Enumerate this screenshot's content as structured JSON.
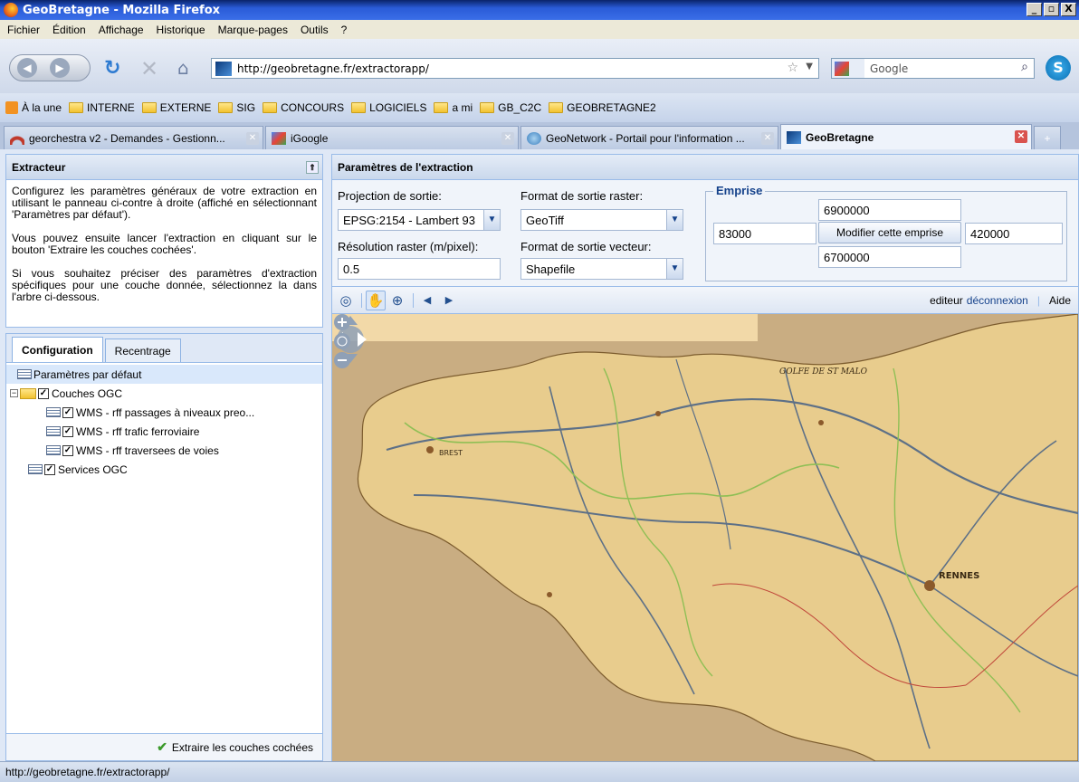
{
  "window": {
    "title": "GeoBretagne - Mozilla Firefox",
    "buttons": [
      "_",
      "▫",
      "X"
    ]
  },
  "menu": [
    "Fichier",
    "Édition",
    "Affichage",
    "Historique",
    "Marque-pages",
    "Outils",
    "?"
  ],
  "nav": {
    "url": "http://geobretagne.fr/extractorapp/",
    "search_engine": "Google",
    "search_placeholder": "Google"
  },
  "bookmarks": [
    {
      "label": "À la une",
      "icon": "rss-icon"
    },
    {
      "label": "INTERNE",
      "icon": "folder-icon"
    },
    {
      "label": "EXTERNE",
      "icon": "folder-icon"
    },
    {
      "label": "SIG",
      "icon": "folder-icon"
    },
    {
      "label": "CONCOURS",
      "icon": "folder-icon"
    },
    {
      "label": "LOGICIELS",
      "icon": "folder-icon"
    },
    {
      "label": "a mi",
      "icon": "folder-icon"
    },
    {
      "label": "GB_C2C",
      "icon": "folder-icon"
    },
    {
      "label": "GEOBRETAGNE2",
      "icon": "folder-icon"
    }
  ],
  "tabs": [
    {
      "label": "georchestra v2 - Demandes - Gestionn...",
      "active": false
    },
    {
      "label": "iGoogle",
      "active": false
    },
    {
      "label": "GeoNetwork - Portail pour l'information ...",
      "active": false
    },
    {
      "label": "GeoBretagne",
      "active": true
    }
  ],
  "extracteur": {
    "title": "Extracteur",
    "paragraphs": [
      "Configurez les paramètres généraux de votre extraction en utilisant le panneau ci-contre à droite (affiché en sélectionnant 'Paramètres par défaut').",
      "Vous pouvez ensuite lancer l'extraction en cliquant sur le bouton 'Extraire les couches cochées'.",
      "Si vous souhaitez préciser des paramètres d'extraction spécifiques pour une couche donnée, sélectionnez la dans l'arbre ci-dessous."
    ]
  },
  "config": {
    "tabs": [
      "Configuration",
      "Recentrage"
    ],
    "tree": {
      "defaults": "Paramètres par défaut",
      "ogc_layers": "Couches OGC",
      "layers": [
        "WMS - rff passages à niveaux preo...",
        "WMS - rff trafic ferroviaire",
        "WMS - rff traversees de voies"
      ],
      "services": "Services OGC"
    },
    "extract_button": "Extraire les couches cochées"
  },
  "params": {
    "title": "Paramètres de l'extraction",
    "projection_label": "Projection de sortie:",
    "projection_value": "EPSG:2154 - Lambert 93",
    "resolution_label": "Résolution raster (m/pixel):",
    "resolution_value": "0.5",
    "raster_format_label": "Format de sortie raster:",
    "raster_format_value": "GeoTiff",
    "vector_format_label": "Format de sortie vecteur:",
    "vector_format_value": "Shapefile",
    "emprise_label": "Emprise",
    "emprise_top": "6900000",
    "emprise_left": "83000",
    "emprise_right": "420000",
    "emprise_bottom": "6700000",
    "emprise_button": "Modifier cette emprise"
  },
  "map_toolbar": {
    "user": "editeur",
    "logout": "déconnexion",
    "help": "Aide",
    "separator": "|"
  },
  "map": {
    "labels": [
      "GOLFE DE ST MALO",
      "RENNES",
      "BREST"
    ]
  },
  "status": {
    "text": "http://geobretagne.fr/extractorapp/"
  }
}
